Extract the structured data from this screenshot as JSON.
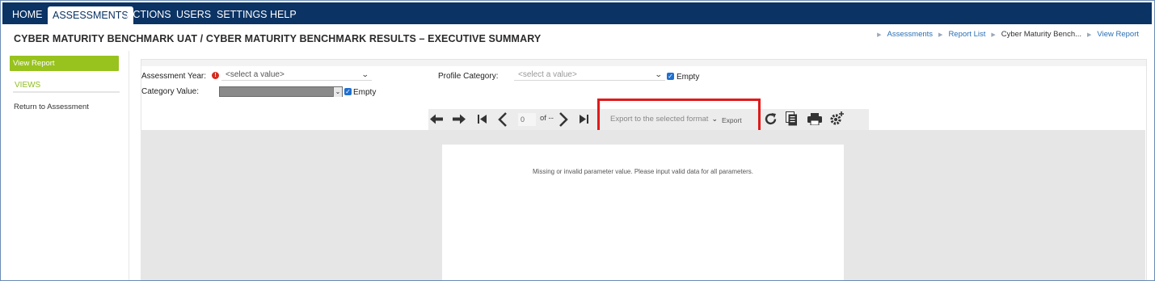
{
  "nav": {
    "items": [
      {
        "label": "HOME"
      },
      {
        "label": "ASSESSMENTS"
      },
      {
        "label": "ACTIONS"
      },
      {
        "label": "USERS"
      },
      {
        "label": "SETTINGS"
      },
      {
        "label": "HELP"
      }
    ],
    "active": "ASSESSMENTS"
  },
  "page": {
    "title": "CYBER MATURITY BENCHMARK UAT / CYBER MATURITY BENCHMARK RESULTS – EXECUTIVE SUMMARY"
  },
  "breadcrumb": {
    "items": [
      {
        "label": "Assessments",
        "link": true
      },
      {
        "label": "Report List",
        "link": true
      },
      {
        "label": "Cyber Maturity Bench...",
        "link": false
      },
      {
        "label": "View Report",
        "link": true
      }
    ]
  },
  "sidebar": {
    "view_report": "View Report",
    "views_label": "VIEWS",
    "return_link": "Return to Assessment"
  },
  "params": {
    "assessment_year_label": "Assessment Year:",
    "assessment_year_value": "<select a value>",
    "category_value_label": "Category Value:",
    "category_value_value": "",
    "profile_category_label": "Profile Category:",
    "profile_category_value": "<select a value>",
    "empty_label": "Empty"
  },
  "toolbar": {
    "page_value": "0",
    "of_label": "of --",
    "export_format": "Export to the selected format",
    "export_label": "Export"
  },
  "report": {
    "message": "Missing or invalid parameter value. Please input valid data for all parameters."
  },
  "colors": {
    "nav_bg": "#0b3364",
    "accent_green": "#98c21e",
    "link_blue": "#2a6fb3",
    "highlight_red": "#e01a1a"
  }
}
